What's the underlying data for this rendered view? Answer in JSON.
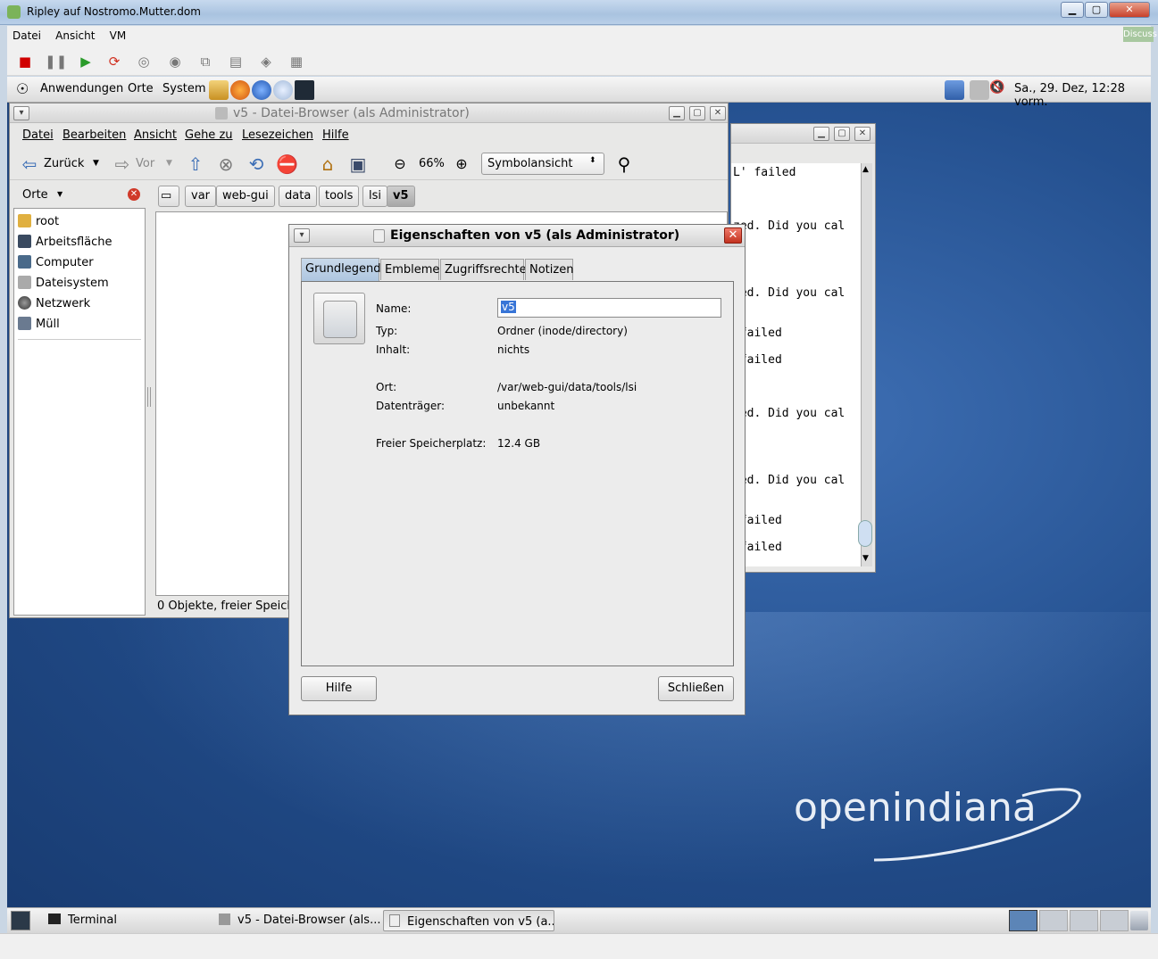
{
  "vm": {
    "title": "Ripley auf Nostromo.Mutter.dom",
    "menu": [
      "Datei",
      "Ansicht",
      "VM"
    ],
    "discuss_label": "Discuss"
  },
  "panel": {
    "items": [
      "Anwendungen",
      "Orte",
      "System"
    ],
    "clock": "Sa., 29. Dez, 12:28 vorm."
  },
  "filebrowser": {
    "title": "v5 - Datei-Browser (als Administrator)",
    "menu": [
      "Datei",
      "Bearbeiten",
      "Ansicht",
      "Gehe zu",
      "Lesezeichen",
      "Hilfe"
    ],
    "back_label": "Zurück",
    "forward_label": "Vor",
    "zoom": "66%",
    "view_mode": "Symbolansicht",
    "sidebar_header": "Orte",
    "places": [
      "root",
      "Arbeitsfläche",
      "Computer",
      "Dateisystem",
      "Netzwerk",
      "Müll"
    ],
    "path": [
      "var",
      "web-gui",
      "data",
      "tools",
      "lsi",
      "v5"
    ],
    "status": "0 Objekte, freier Speiche"
  },
  "terminal": {
    "lines": [
      "L' failed",
      "zed. Did you cal",
      "zed. Did you cal",
      " failed",
      " failed",
      "zed. Did you cal",
      "zed. Did you cal",
      " failed",
      " failed"
    ]
  },
  "properties": {
    "title": "Eigenschaften von v5 (als Administrator)",
    "tabs": [
      "Grundlegend",
      "Embleme",
      "Zugriffsrechte",
      "Notizen"
    ],
    "name_label": "Name:",
    "name_value": "v5",
    "type_label": "Typ:",
    "type_value": "Ordner (inode/directory)",
    "content_label": "Inhalt:",
    "content_value": "nichts",
    "location_label": "Ort:",
    "location_value": "/var/web-gui/data/tools/lsi",
    "volume_label": "Datenträger:",
    "volume_value": "unbekannt",
    "free_label": "Freier Speicherplatz:",
    "free_value": "12.4 GB",
    "help_button": "Hilfe",
    "close_button": "Schließen"
  },
  "desktop": {
    "logo": "openindiana"
  },
  "taskbar": {
    "tasks": [
      "Terminal",
      "v5 - Datei-Browser (als...",
      "Eigenschaften von v5 (a..."
    ]
  }
}
